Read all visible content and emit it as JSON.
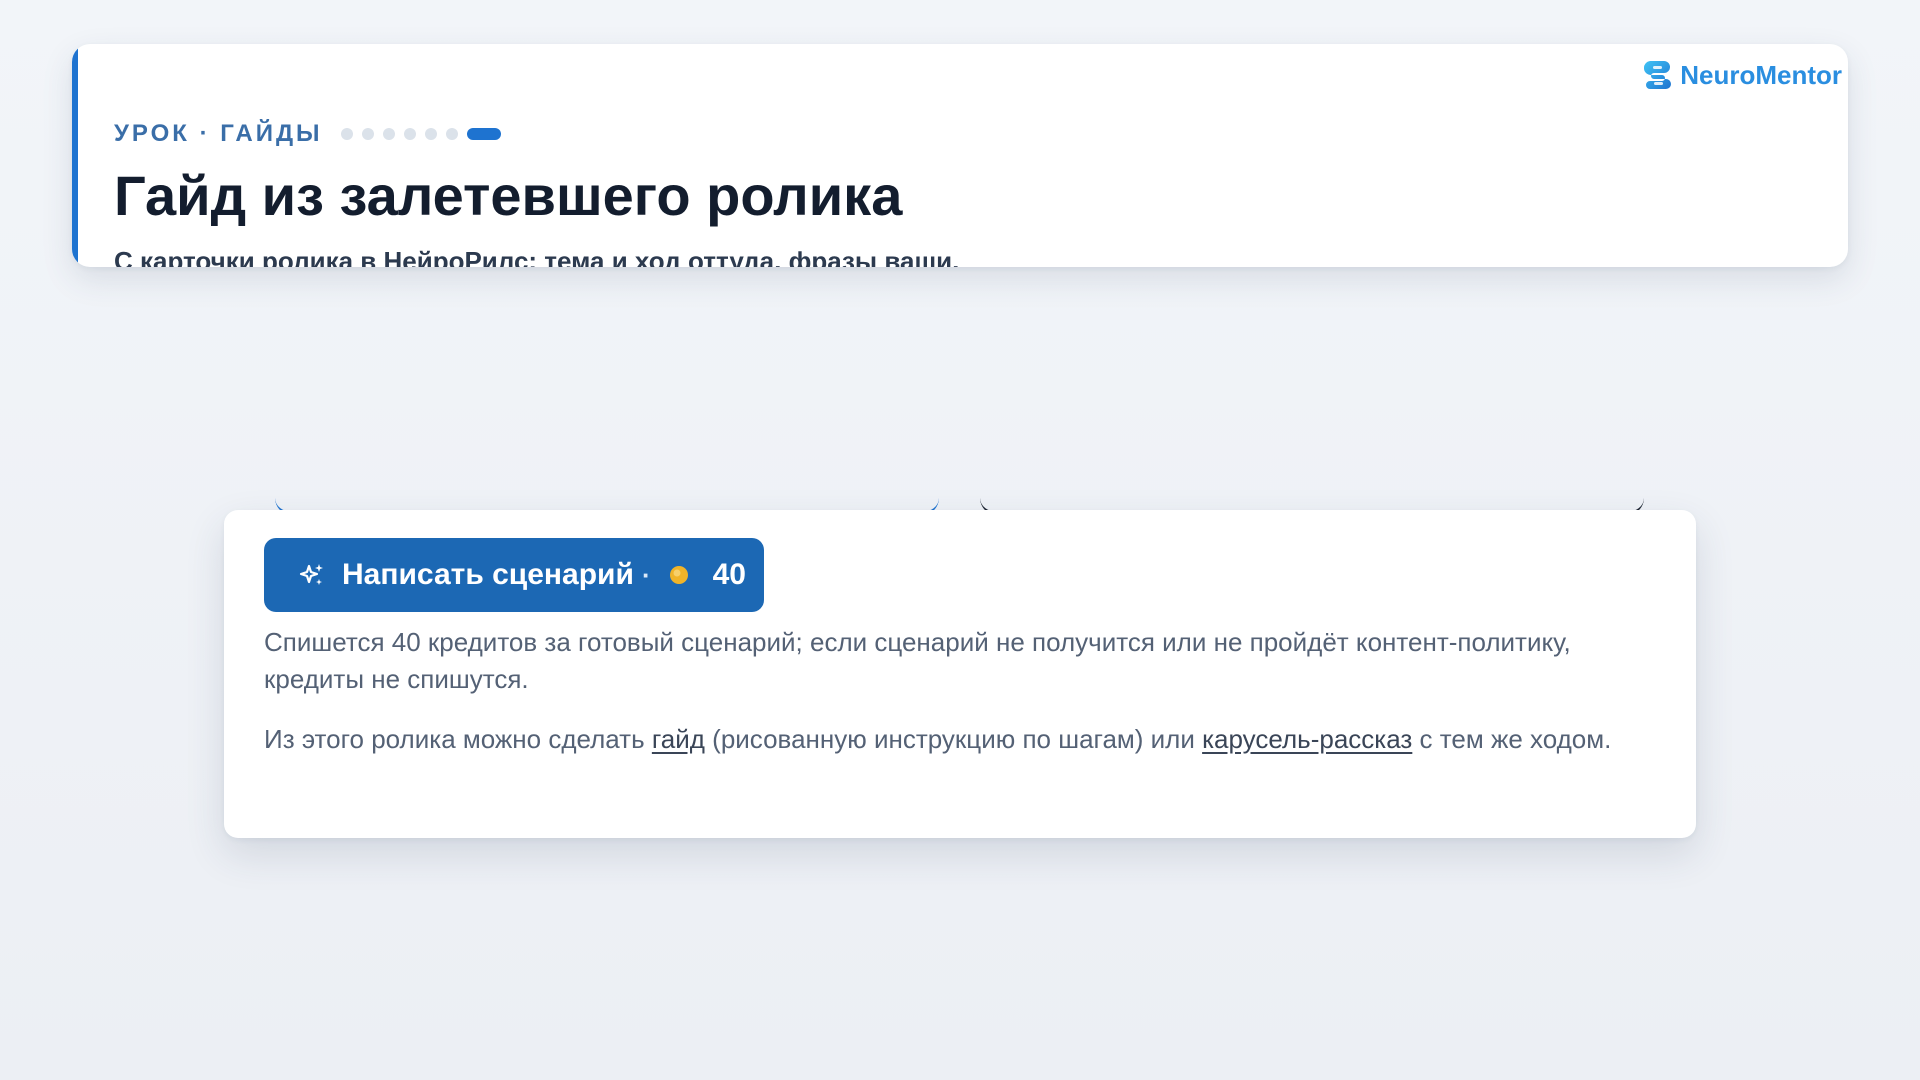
{
  "header": {
    "eyebrow": "УРОК · ГАЙДЫ",
    "progress": {
      "total_steps": 7,
      "current_step": 7
    },
    "title": "Гайд из залетевшего ролика",
    "subtitle": "С карточки ролика в НейроРилс: тема и ход оттуда, фразы ваши.",
    "brand_name": "NeuroMentor",
    "accent_color": "#1e73d0"
  },
  "action": {
    "icon": "sparkle-icon",
    "label": "Написать сценарий",
    "separator": "·",
    "cost_icon": "coin-icon",
    "cost": "40",
    "button_color": "#1c68b4",
    "coin_color": "#f0b429"
  },
  "notes": {
    "cost_note": "Спишется 40 кредитов за готовый сценарий; если сценарий не получится или не пройдёт контент-политику, кредиты не спишутся.",
    "alt_prefix": "Из этого ролика можно сделать ",
    "alt_link_guide": "гайд",
    "alt_middle": " (рисованную инструкцию по шагам) или ",
    "alt_link_carousel": "карусель-рассказ",
    "alt_suffix": " с тем же ходом."
  }
}
